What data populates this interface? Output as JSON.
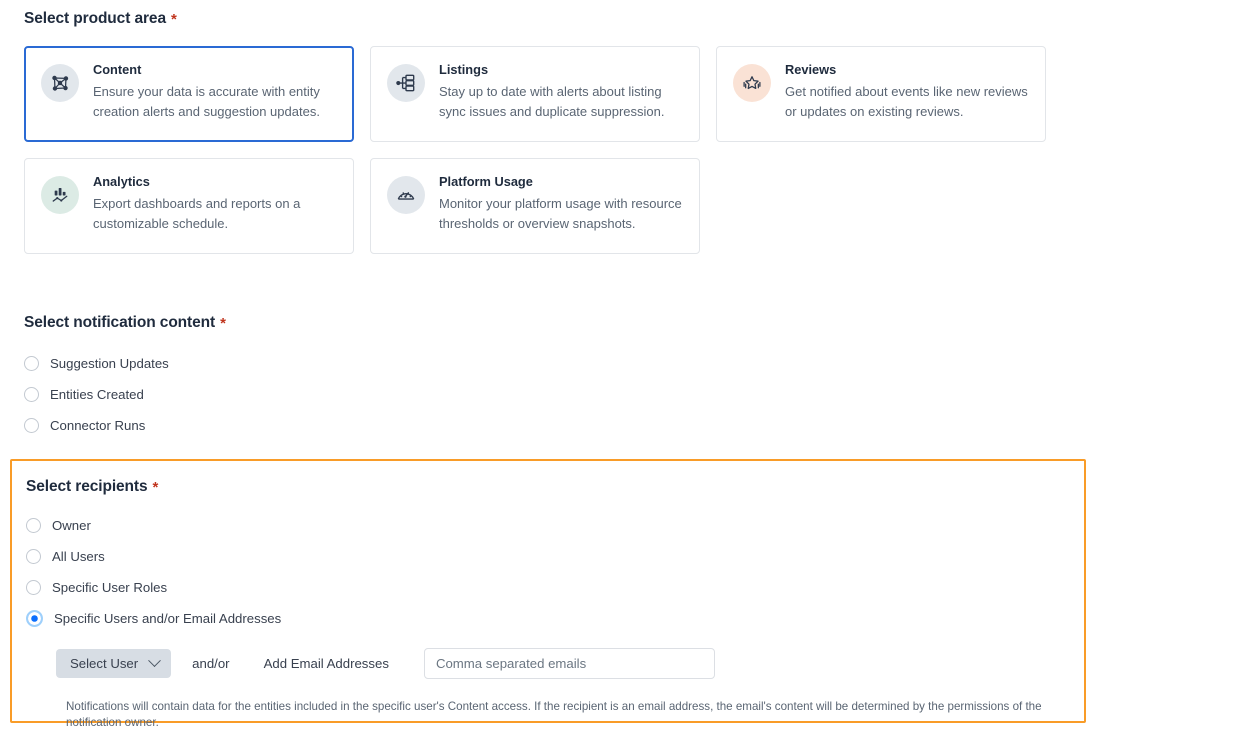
{
  "colors": {
    "selected_card_border": "#2a6ad4",
    "highlight_border": "#f99c28",
    "radio_selected": "#0b6efd",
    "required_marker": "#c0341d"
  },
  "product_area": {
    "heading": "Select product area",
    "required_marker": "*",
    "cards": [
      {
        "title": "Content",
        "description": "Ensure your data is accurate with entity creation alerts and suggestion updates.",
        "icon": "network-graph-icon",
        "icon_bg": "gray",
        "selected": true
      },
      {
        "title": "Listings",
        "description": "Stay up to date with alerts about listing sync issues and duplicate suppression.",
        "icon": "sitemap-icon",
        "icon_bg": "gray",
        "selected": false
      },
      {
        "title": "Reviews",
        "description": "Get notified about events like new reviews or updates on existing reviews.",
        "icon": "star-sparkle-icon",
        "icon_bg": "peach",
        "selected": false
      },
      {
        "title": "Analytics",
        "description": "Export dashboards and reports on a customizable schedule.",
        "icon": "bar-chart-line-icon",
        "icon_bg": "mint",
        "selected": false
      },
      {
        "title": "Platform Usage",
        "description": "Monitor your platform usage with resource thresholds or overview snapshots.",
        "icon": "gauge-icon",
        "icon_bg": "gray",
        "selected": false
      }
    ]
  },
  "notification_content": {
    "heading": "Select notification content",
    "required_marker": "*",
    "options": [
      {
        "label": "Suggestion Updates",
        "selected": false
      },
      {
        "label": "Entities Created",
        "selected": false
      },
      {
        "label": "Connector Runs",
        "selected": false
      }
    ]
  },
  "recipients": {
    "heading": "Select recipients",
    "required_marker": "*",
    "options": [
      {
        "label": "Owner",
        "selected": false
      },
      {
        "label": "All Users",
        "selected": false
      },
      {
        "label": "Specific User Roles",
        "selected": false
      },
      {
        "label": "Specific Users and/or Email Addresses",
        "selected": true
      }
    ],
    "controls": {
      "select_user_button": "Select User",
      "select_user_chevron": "chevron-down-icon",
      "and_or_text": "and/or",
      "add_email_label": "Add Email Addresses",
      "email_input_value": "",
      "email_input_placeholder": "Comma separated emails"
    },
    "footnote": "Notifications will contain data for the entities included in the specific user's Content access. If the recipient is an email address, the email's content will be determined by the permissions of the notification owner."
  }
}
